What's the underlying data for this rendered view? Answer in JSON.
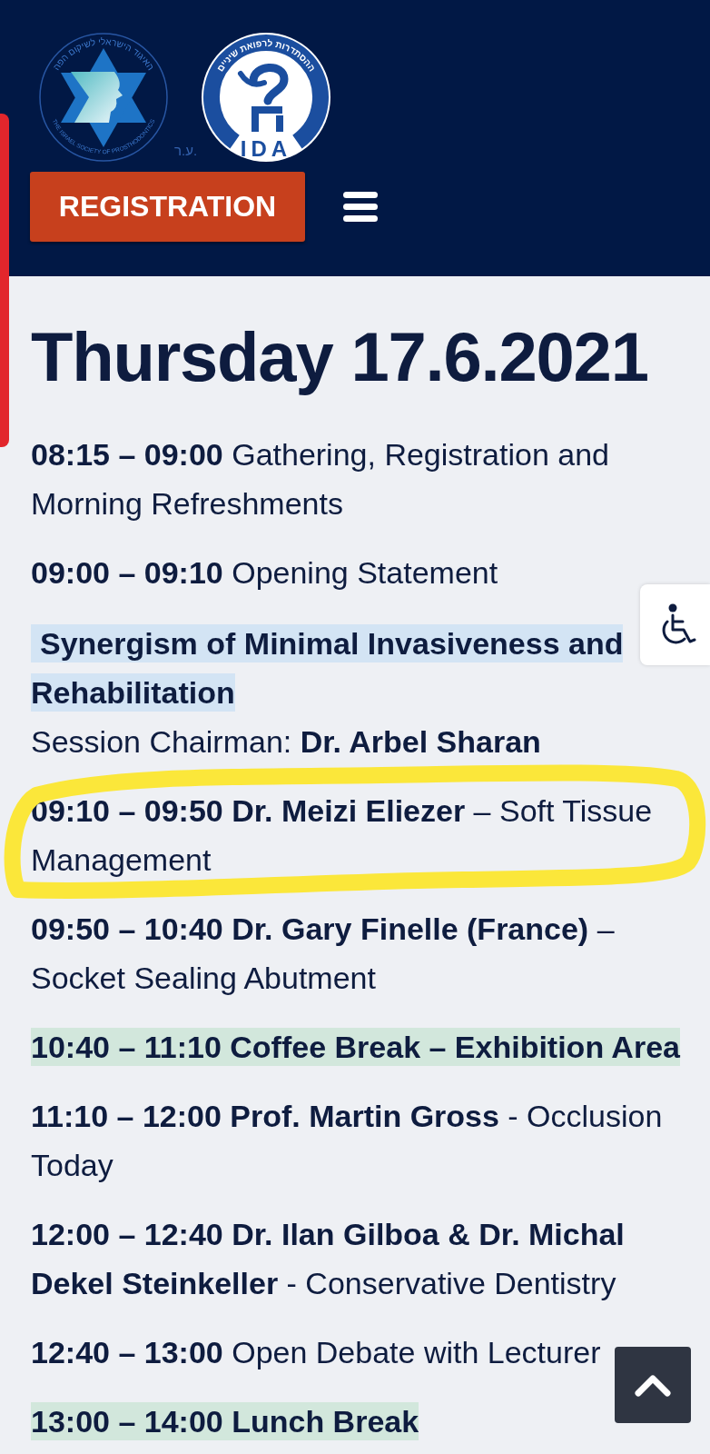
{
  "header": {
    "society_logo": {
      "ring_text": "האיגוד הישראלי לשיקום הפה",
      "ring_text_en": "THE ISRAEL SOCIETY OF PROSTHODONTICS",
      "note": "ע.ר."
    },
    "association_logo": {
      "ring_text": "ההסתדרות לרפואת שיניים",
      "initials": "IDA"
    },
    "registration_button": "REGISTRATION"
  },
  "day_title": "Thursday 17.6.2021",
  "schedule": [
    {
      "kind": "talk",
      "text": "**08:15 – 09:00** Gathering, Registration and Morning Refreshments",
      "circled": false
    },
    {
      "kind": "talk",
      "text": "**09:00 – 09:10** Opening Statement",
      "circled": false
    },
    {
      "kind": "session",
      "title": "Synergism of Minimal Invasiveness and Rehabilitation",
      "chair": "Session Chairman: **Dr. Arbel Sharan**",
      "circled": false
    },
    {
      "kind": "talk",
      "text": "**09:10 – 09:50 Dr. Meizi Eliezer** – Soft Tissue Management",
      "circled": true
    },
    {
      "kind": "talk",
      "text": "**09:50 – 10:40 Dr. Gary Finelle (France)** – Socket Sealing Abutment",
      "circled": false
    },
    {
      "kind": "break",
      "text": "10:40 – 11:10 Coffee Break – Exhibition Area",
      "circled": false
    },
    {
      "kind": "talk",
      "text": "**11:10 – 12:00 Prof. Martin Gross** - Occlusion Today",
      "circled": false
    },
    {
      "kind": "talk",
      "text": "**12:00 – 12:40 Dr. Ilan Gilboa & Dr. Michal Dekel Steinkeller** - Conservative Dentistry",
      "circled": false
    },
    {
      "kind": "talk",
      "text": "**12:40 – 13:00** Open Debate with Lecturer",
      "circled": false
    },
    {
      "kind": "break",
      "text": "13:00 – 14:00 Lunch Break",
      "circled": false
    }
  ]
}
